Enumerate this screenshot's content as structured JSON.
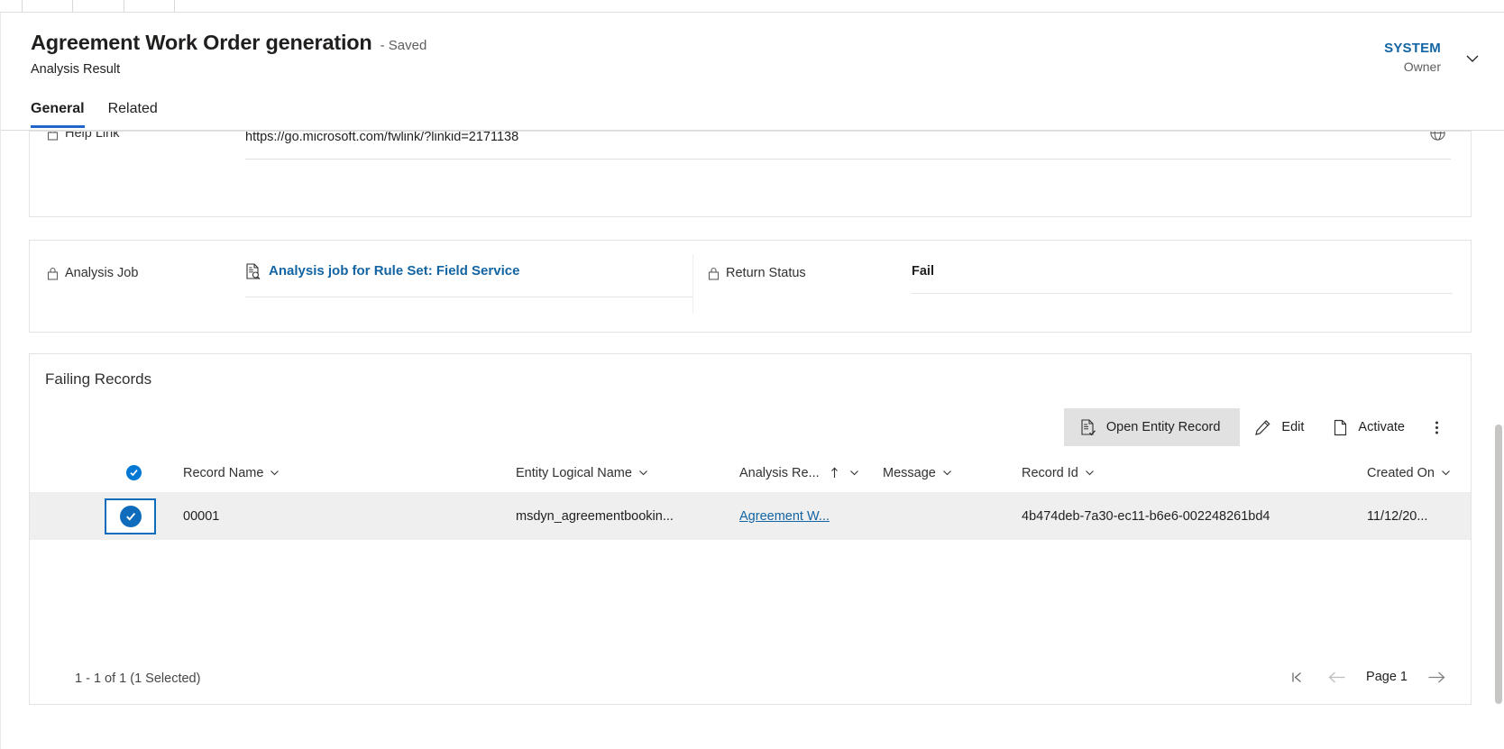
{
  "header": {
    "record_title": "Agreement Work Order generation",
    "save_state": "- Saved",
    "entity_name": "Analysis Result",
    "owner_name": "SYSTEM",
    "owner_role": "Owner"
  },
  "tabs": [
    {
      "label": "General",
      "active": true
    },
    {
      "label": "Related",
      "active": false
    }
  ],
  "help_section": {
    "label": "Help Link",
    "value": "https://go.microsoft.com/fwlink/?linkid=2171138"
  },
  "job_section": {
    "analysis_job_label": "Analysis Job",
    "analysis_job_value": "Analysis job for Rule Set: Field Service",
    "return_status_label": "Return Status",
    "return_status_value": "Fail"
  },
  "subgrid": {
    "title": "Failing Records",
    "commands": [
      {
        "label": "Open Entity Record",
        "icon": "open-entity-record-icon",
        "selected": true
      },
      {
        "label": "Edit",
        "icon": "pencil-icon",
        "selected": false
      },
      {
        "label": "Activate",
        "icon": "page-icon",
        "selected": false
      }
    ],
    "overflow_label": "More commands",
    "columns": [
      {
        "label": "Record Name",
        "sorted": false
      },
      {
        "label": "Entity Logical Name",
        "sorted": false
      },
      {
        "label": "Analysis Re...",
        "sorted": true,
        "sort_dir": "asc"
      },
      {
        "label": "Message",
        "sorted": false
      },
      {
        "label": "Record Id",
        "sorted": false
      },
      {
        "label": "Created On",
        "sorted": false
      }
    ],
    "rows": [
      {
        "selected": true,
        "record_name": "00001",
        "entity_logical_name": "msdyn_agreementbookin...",
        "analysis_result": "Agreement W...",
        "message": "",
        "record_id": "4b474deb-7a30-ec11-b6e6-002248261bd4",
        "created_on": "11/12/20..."
      }
    ],
    "footer_count": "1 - 1 of 1 (1 Selected)",
    "page_label": "Page 1"
  },
  "colors": {
    "accent": "#1264a3",
    "tab_underline": "#2266cc",
    "selection": "#0f6cbd",
    "row_selected_bg": "#efefef",
    "command_selected_bg": "#e1e1e1"
  }
}
